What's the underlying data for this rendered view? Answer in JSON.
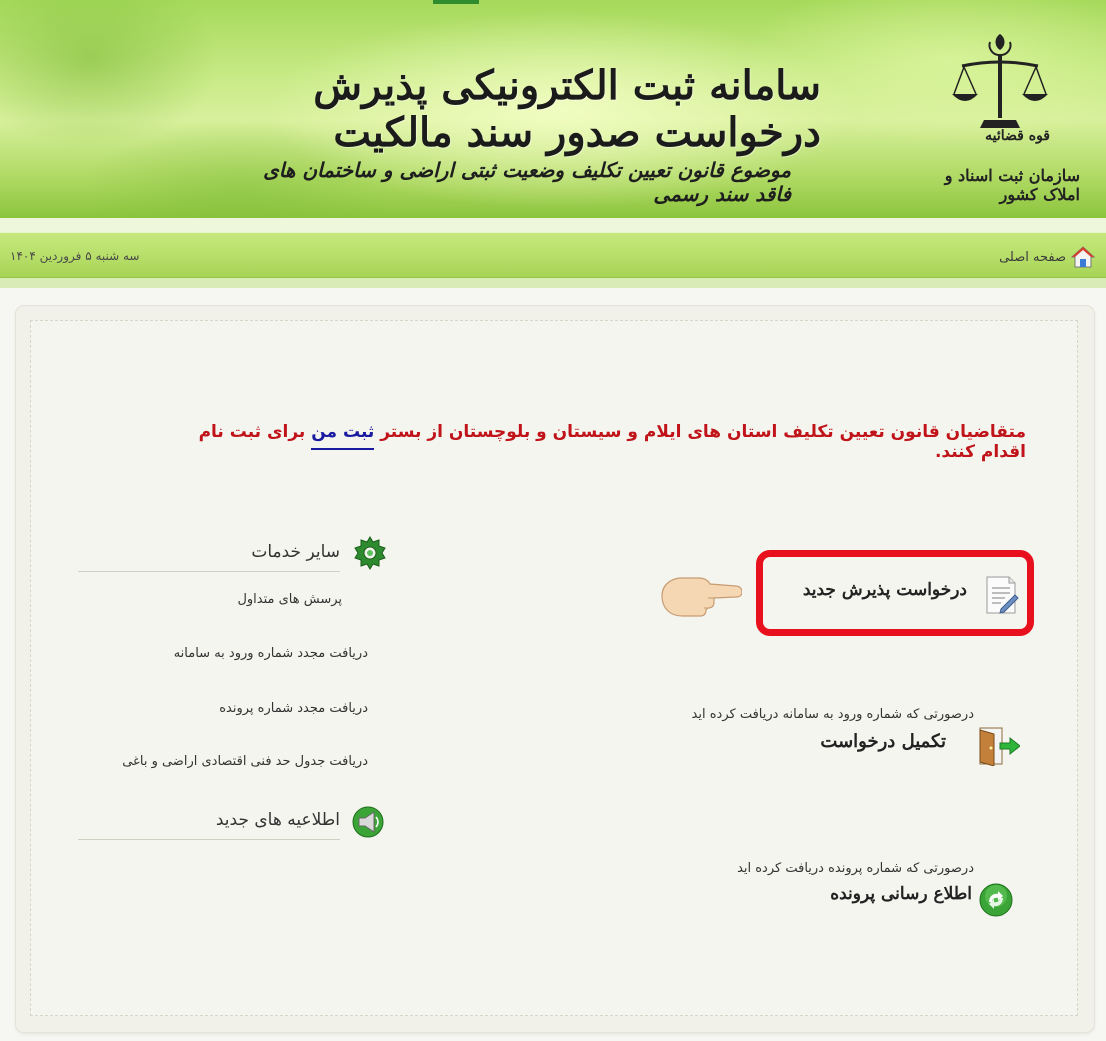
{
  "header": {
    "title": "سامانه ثبت الکترونیکی پذیرش درخواست صدور سند مالکیت",
    "subtitle": "موضوع قانون تعیین تکلیف وضعیت ثبتی اراضی و ساختمان های فاقد سند رسمی",
    "org_line1": "قوه قضائیه",
    "org_line2": "سازمان ثبت اسناد و املاک کشور"
  },
  "nav": {
    "home_label": "صفحه اصلی",
    "date": "سه شنبه ۵ فروردین ۱۴۰۴"
  },
  "notice": {
    "before": "متقاضیان قانون تعیین تکلیف استان های ایلام و سیستان و بلوچستان از بستر ",
    "link": "ثبت من",
    "after": " برای ثبت نام اقدام کنند."
  },
  "actions": {
    "new_request": "درخواست پذیرش جدید",
    "complete_hint": "درصورتی که شماره ورود به سامانه دریافت کرده اید",
    "complete_label": "تکمیل درخواست",
    "inform_hint": "درصورتی که شماره پرونده دریافت کرده اید",
    "inform_label": "اطلاع رسانی پرونده"
  },
  "other_services": {
    "title": "سایر خدمات",
    "items": [
      "پرسش های متداول",
      "دریافت مجدد شماره ورود به سامانه",
      "دریافت مجدد شماره پرونده",
      "دریافت جدول حد فنی اقتصادی اراضی و باغی"
    ]
  },
  "news": {
    "title": "اطلاعیه های جدید"
  },
  "colors": {
    "notice_red": "#c0141a",
    "link_blue": "#1a1aa0",
    "highlight_red": "#e8101c",
    "banner_green": "#a5d95a"
  }
}
